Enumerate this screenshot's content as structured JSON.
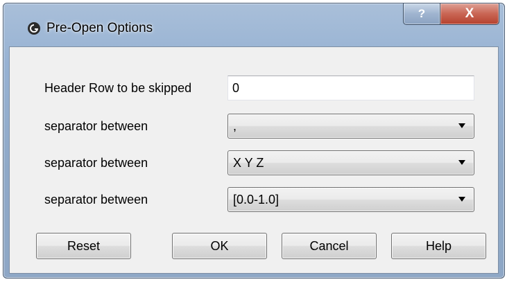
{
  "window": {
    "title": "Pre-Open Options",
    "app_icon": "app-logo-icon",
    "help_glyph": "?",
    "close_glyph": "X"
  },
  "form": {
    "header_rows": {
      "label": "Header Row to be skipped",
      "value": "0"
    },
    "separators": [
      {
        "label": "separator between",
        "value": ","
      },
      {
        "label": "separator between",
        "value": "X Y Z"
      },
      {
        "label": "separator between",
        "value": "[0.0-1.0]"
      }
    ]
  },
  "buttons": {
    "reset": "Reset",
    "ok": "OK",
    "cancel": "Cancel",
    "help": "Help"
  },
  "colors": {
    "title_bar": "#97b2d3",
    "close_button": "#c96554",
    "dialog_background": "#f0f0f0"
  }
}
